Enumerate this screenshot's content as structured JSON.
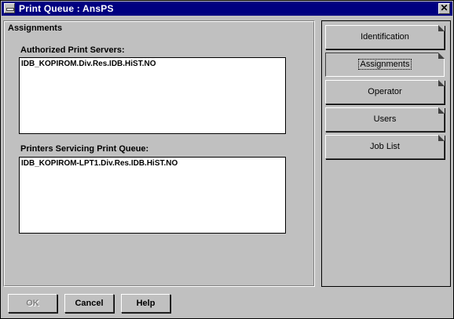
{
  "window": {
    "title": "Print Queue : AnsPS",
    "close_glyph": "✕"
  },
  "panel": {
    "title": "Assignments",
    "servers_label": "Authorized Print Servers:",
    "servers": [
      "IDB_KOPIROM.Div.Res.IDB.HiST.NO"
    ],
    "printers_label": "Printers Servicing Print Queue:",
    "printers": [
      "IDB_KOPIROM-LPT1.Div.Res.IDB.HiST.NO"
    ]
  },
  "tabs": [
    {
      "label": "Identification",
      "active": false
    },
    {
      "label": "Assignments",
      "active": true
    },
    {
      "label": "Operator",
      "active": false
    },
    {
      "label": "Users",
      "active": false
    },
    {
      "label": "Job List",
      "active": false
    }
  ],
  "buttons": {
    "ok": "OK",
    "cancel": "Cancel",
    "help": "Help"
  }
}
